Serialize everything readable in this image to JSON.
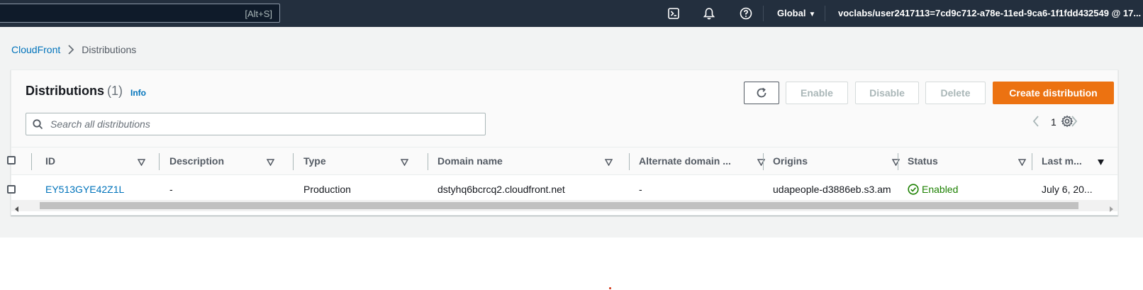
{
  "topbar": {
    "search_shortcut": "[Alt+S]",
    "icons": [
      "cloudshell-icon",
      "notifications-icon",
      "help-icon"
    ],
    "region": "Global",
    "account": "voclabs/user2417113=7cd9c712-a78e-11ed-9ca6-1f1fdd432549 @ 17..."
  },
  "breadcrumb": {
    "root": "CloudFront",
    "current": "Distributions"
  },
  "panel": {
    "title": "Distributions",
    "count": "(1)",
    "info": "Info",
    "buttons": {
      "enable": "Enable",
      "disable": "Disable",
      "delete": "Delete",
      "create": "Create distribution"
    },
    "search_placeholder": "Search all distributions",
    "page": "1"
  },
  "table": {
    "headers": {
      "id": "ID",
      "description": "Description",
      "type": "Type",
      "domain": "Domain name",
      "alternate": "Alternate domain ...",
      "origins": "Origins",
      "status": "Status",
      "last_modified": "Last m..."
    },
    "rows": [
      {
        "id": "EY513GYE42Z1L",
        "description": "-",
        "type": "Production",
        "domain": "dstyhq6bcrcq2.cloudfront.net",
        "alternate": "-",
        "origins": "udapeople-d3886eb.s3.am",
        "status": "Enabled",
        "last_modified": "July 6, 20..."
      }
    ]
  },
  "colors": {
    "nav_bg": "#232f3e",
    "accent": "#ec7211",
    "link": "#0073bb",
    "success": "#1d8102"
  }
}
